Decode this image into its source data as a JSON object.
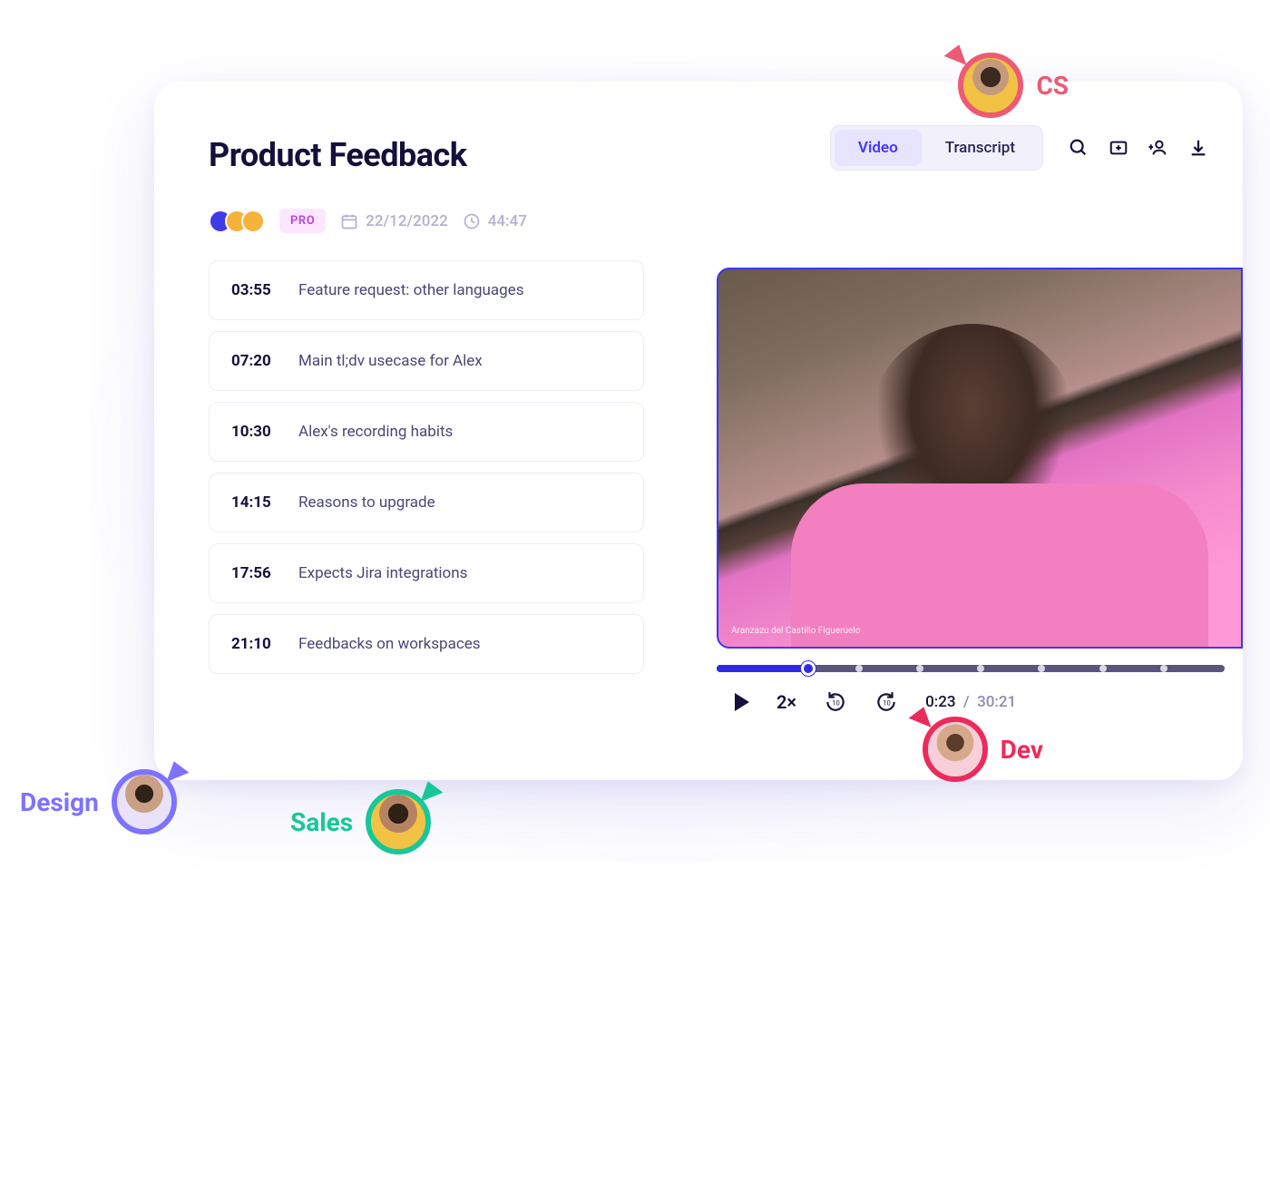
{
  "header": {
    "title": "Product Feedback",
    "tabs": {
      "video": "Video",
      "transcript": "Transcript"
    }
  },
  "meta": {
    "pro_badge": "PRO",
    "date": "22/12/2022",
    "duration": "44:47"
  },
  "chapters": [
    {
      "time": "03:55",
      "label": "Feature request: other languages"
    },
    {
      "time": "07:20",
      "label": "Main tl;dv usecase for Alex"
    },
    {
      "time": "10:30",
      "label": "Alex's recording habits"
    },
    {
      "time": "14:15",
      "label": "Reasons to upgrade"
    },
    {
      "time": "17:56",
      "label": "Expects Jira integrations"
    },
    {
      "time": "21:10",
      "label": "Feedbacks on workspaces"
    }
  ],
  "player": {
    "speed": "2×",
    "current": "0:23",
    "sep": "/",
    "total": "30:21",
    "caption": "Aranzazu del Castillo Figueruelo"
  },
  "roles": {
    "cs": "CS",
    "dev": "Dev",
    "design": "Design",
    "sales": "Sales"
  }
}
